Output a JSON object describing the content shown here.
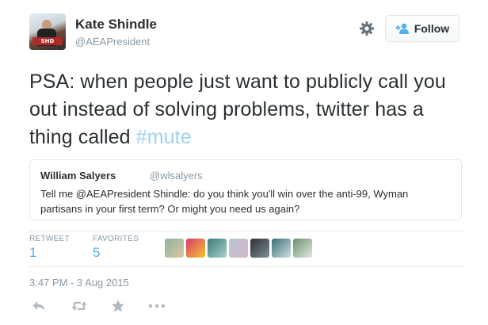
{
  "author": {
    "name": "Kate Shindle",
    "handle": "@AEAPresident",
    "avatar_sign_text": "SHD"
  },
  "follow_button": {
    "label": "Follow",
    "icon": "person-plus-icon"
  },
  "settings": {
    "icon": "gear-icon"
  },
  "tweet": {
    "text": "PSA: when people just want to publicly call you out instead of solving problems, twitter has a thing called ",
    "hashtag": "#mute"
  },
  "quoted_tweet": {
    "name": "William Salyers",
    "handle": "@wlsalyers",
    "text": "Tell me @AEAPresident Shindle: do you think you'll win over the anti-99, Wyman partisans in your first term? Or might you need us again?"
  },
  "stats": {
    "retweets_label": "RETWEET",
    "retweets_count": "1",
    "favorites_label": "FAVORITES",
    "favorites_count": "5"
  },
  "favoriter_avatars": [
    {
      "color_a": "#8fb3a0",
      "color_b": "#d9c7a1"
    },
    {
      "color_a": "#d93a6b",
      "color_b": "#f4c430"
    },
    {
      "color_a": "#3c7a7a",
      "color_b": "#a7d1c8"
    },
    {
      "color_a": "#b8c7d4",
      "color_b": "#d6b4c8"
    },
    {
      "color_a": "#303030",
      "color_b": "#7a8f99"
    },
    {
      "color_a": "#3c6e73",
      "color_b": "#cfe0e0"
    },
    {
      "color_a": "#6e8f6a",
      "color_b": "#e0eae0"
    }
  ],
  "timestamp": "3:47 PM - 3 Aug 2015",
  "actions": [
    {
      "name": "reply-icon"
    },
    {
      "name": "retweet-icon"
    },
    {
      "name": "favorite-star-icon"
    },
    {
      "name": "more-icon"
    }
  ],
  "colors": {
    "link_blue": "#55acee",
    "hashtag_blue": "#9fd0f4",
    "muted_gray": "#8899a6",
    "text_dark": "#292f33",
    "border": "#e1e8ed"
  }
}
